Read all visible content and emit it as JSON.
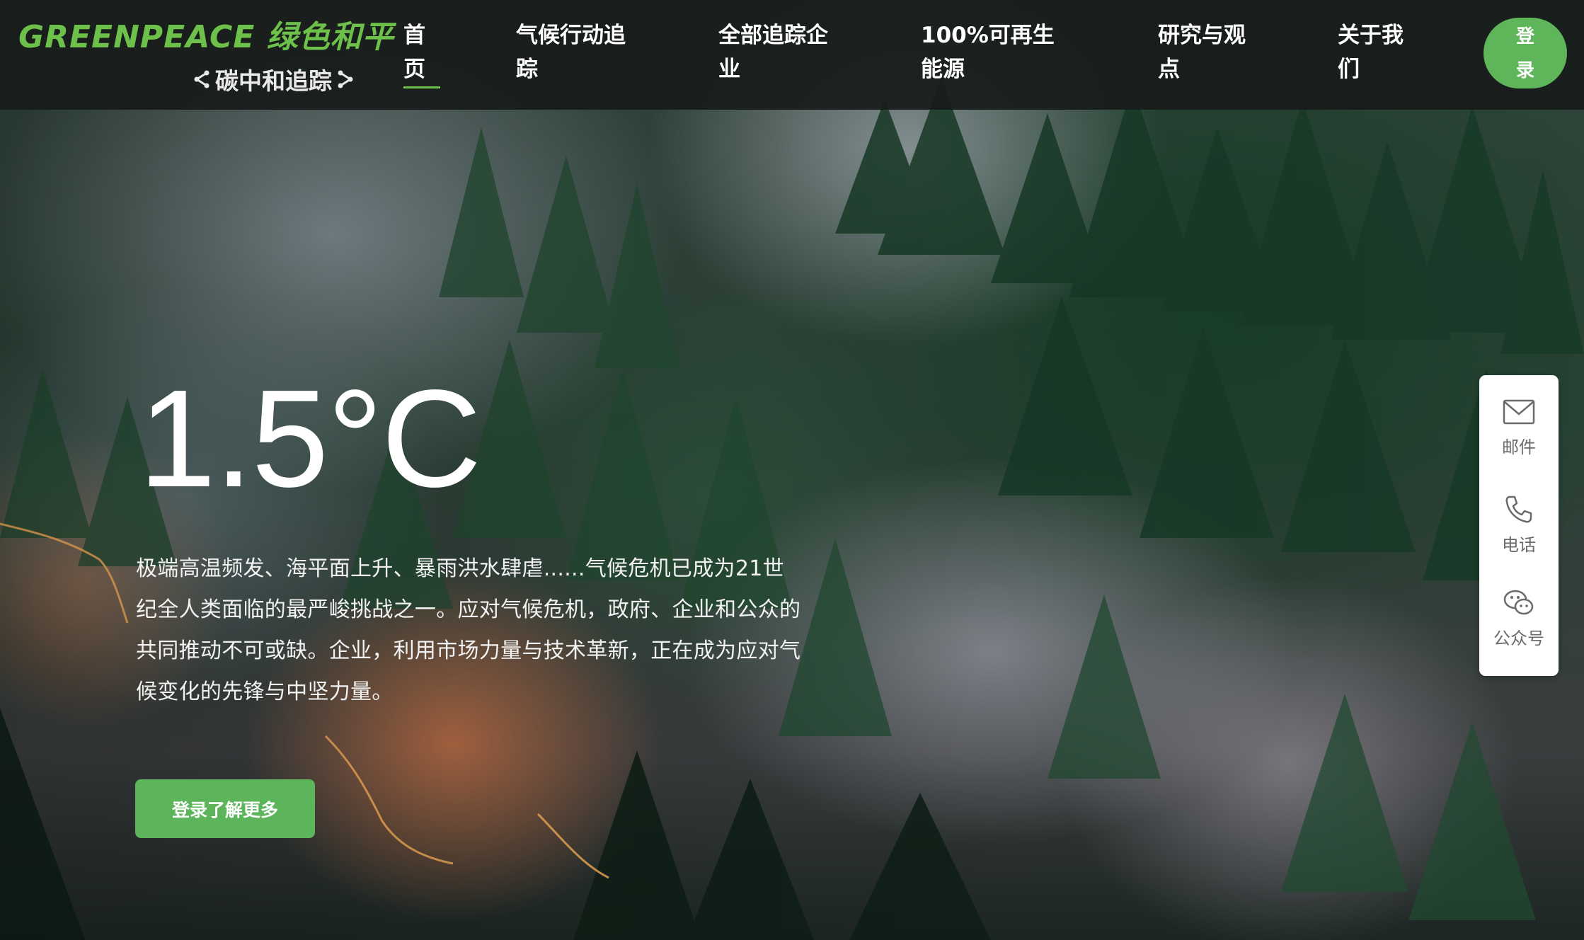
{
  "brand": {
    "logo_text": "GREENPEACE 绿色和平",
    "subtitle": "碳中和追踪",
    "accent_color": "#6dc04a"
  },
  "nav": {
    "items": [
      {
        "label": "首页",
        "active": true
      },
      {
        "label": "气候行动追踪",
        "active": false
      },
      {
        "label": "全部追踪企业",
        "active": false
      },
      {
        "label": "100%可再生能源",
        "active": false
      },
      {
        "label": "研究与观点",
        "active": false
      },
      {
        "label": "关于我们",
        "active": false
      }
    ],
    "login_label": "登录",
    "login_color": "#5fb559"
  },
  "hero": {
    "headline": "1.5°C",
    "description": "极端高温频发、海平面上升、暴雨洪水肆虐......气候危机已成为21世纪全人类面临的最严峻挑战之一。应对气候危机，政府、企业和公众的共同推动不可或缺。企业，利用市场力量与技术革新，正在成为应对气候变化的先锋与中坚力量。",
    "cta_label": "登录了解更多",
    "cta_color": "#5cb55b"
  },
  "side_panel": {
    "items": [
      {
        "icon": "mail-icon",
        "label": "邮件"
      },
      {
        "icon": "phone-icon",
        "label": "电话"
      },
      {
        "icon": "wechat-icon",
        "label": "公众号"
      }
    ]
  }
}
